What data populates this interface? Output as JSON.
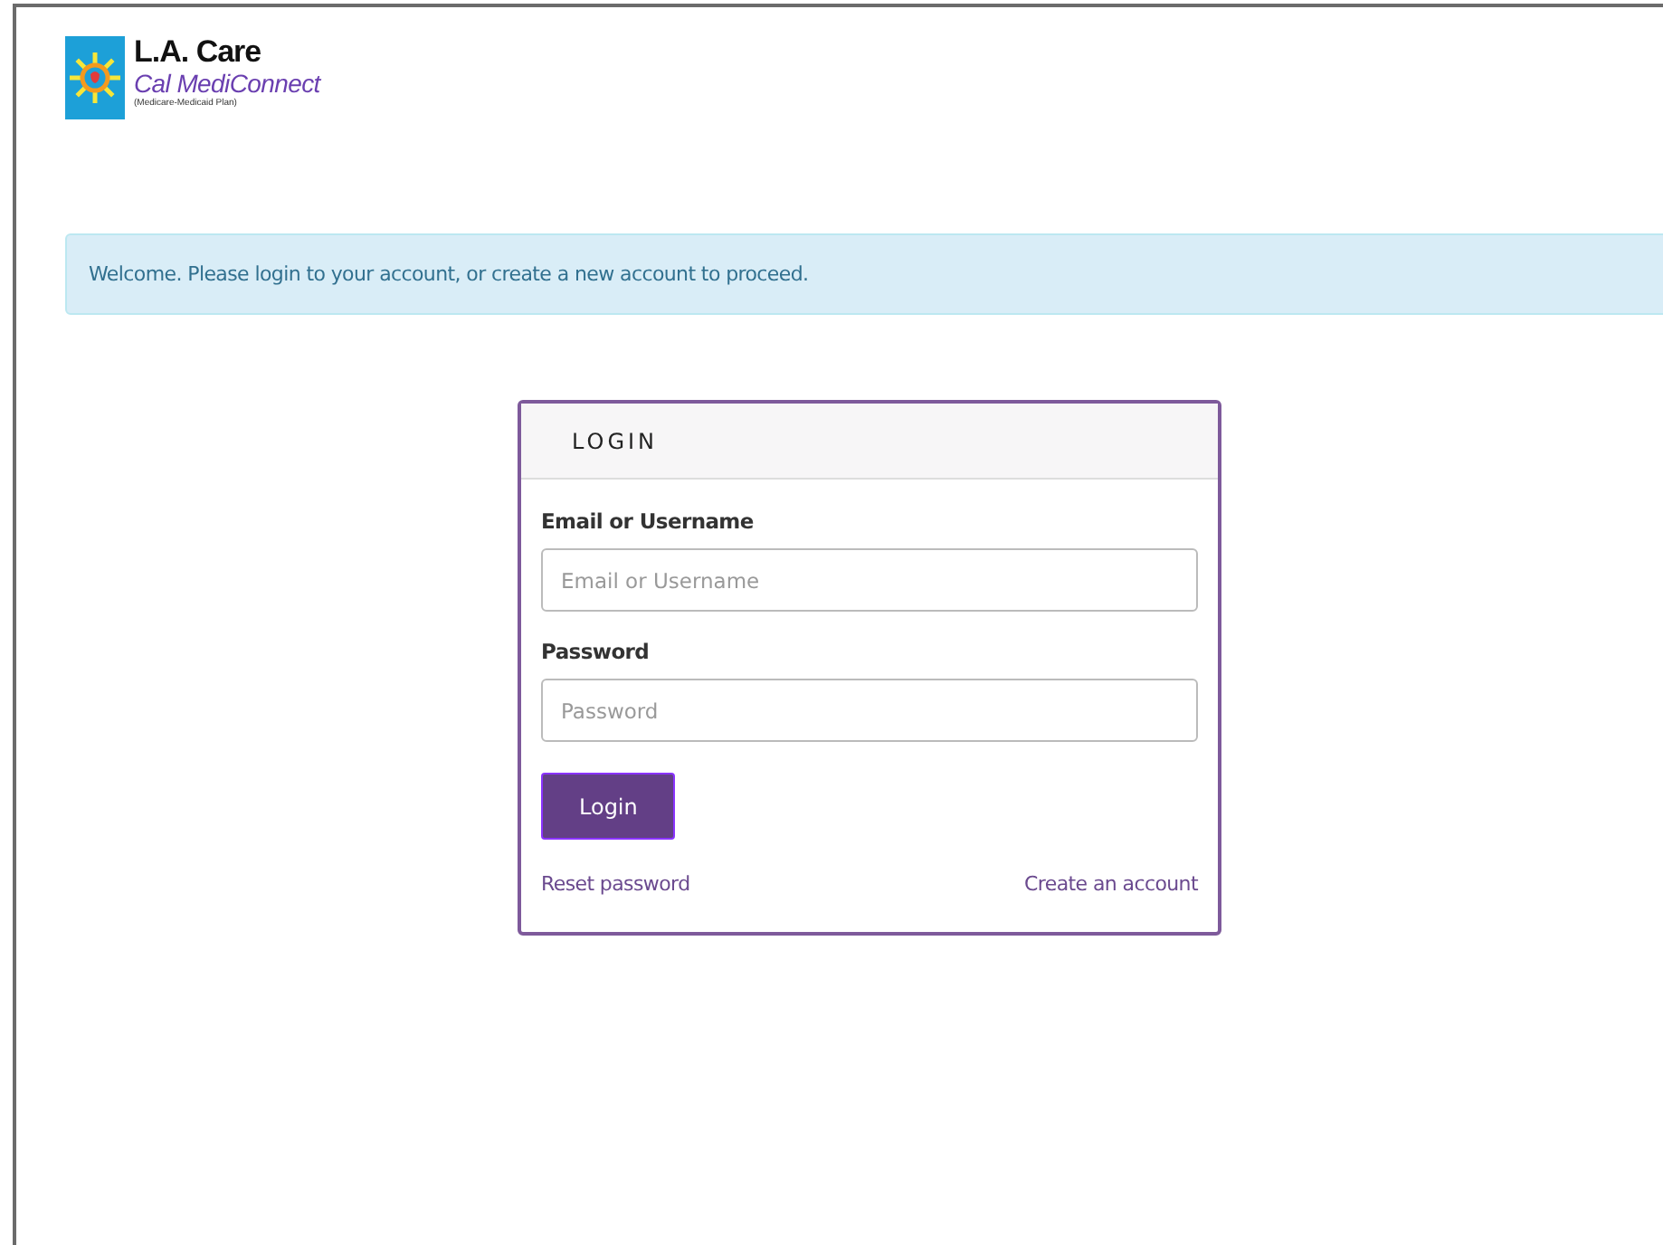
{
  "logo": {
    "name": "L.A. Care",
    "plan": "Cal MediConnect",
    "subtitle": "(Medicare-Medicaid Plan)"
  },
  "alert": {
    "text": "Welcome. Please login to your account, or create a new account to proceed."
  },
  "login": {
    "title": "LOGIN",
    "fields": [
      {
        "label": "Email or Username",
        "placeholder": "Email or Username"
      },
      {
        "label": "Password",
        "placeholder": "Password"
      }
    ],
    "button": "Login",
    "links": [
      "Reset password",
      "Create an account"
    ]
  }
}
